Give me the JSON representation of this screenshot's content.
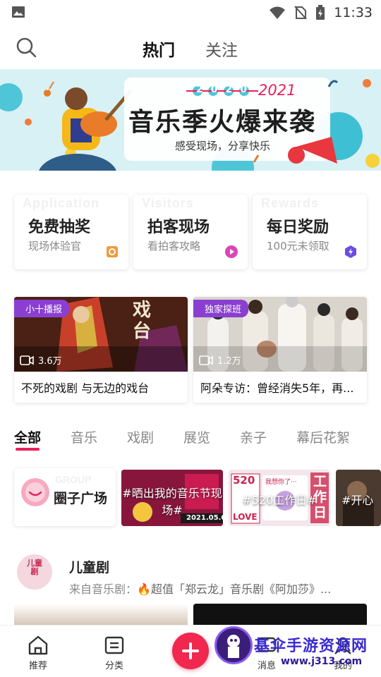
{
  "status_bar": {
    "time": "11:33"
  },
  "top_nav": {
    "tabs": [
      "热门",
      "关注"
    ]
  },
  "banner": {
    "headline": "音乐季火爆来袭",
    "year_old": "2020",
    "year_new": "2021",
    "subline": "感受现场，分享快乐"
  },
  "features": [
    {
      "title": "免费抽奖",
      "sub": "现场体验官",
      "bg_word": "Application",
      "icon": "gift-icon",
      "icon_color": "#f39a3a"
    },
    {
      "title": "拍客现场",
      "sub": "看拍客攻略",
      "bg_word": "Visitors",
      "icon": "play-icon",
      "icon_color": "#d946b8"
    },
    {
      "title": "每日奖励",
      "sub": "100元未领取",
      "bg_word": "Rewards",
      "icon": "reward-icon",
      "icon_color": "#6d4ce0"
    }
  ],
  "videos": [
    {
      "tag": "小十播报",
      "views": "3.6万",
      "title": "不死的戏剧 与无边的戏台",
      "overlay": "戏台"
    },
    {
      "tag": "独家探班",
      "views": "1.2万",
      "title": "阿朵专访：曾经消失5年，再..."
    }
  ],
  "category_tabs": [
    "全部",
    "音乐",
    "戏剧",
    "展览",
    "亲子",
    "幕后花絮"
  ],
  "topics": {
    "circle": {
      "label": "圈子广场",
      "ghost": "GROUP"
    },
    "items": [
      "#晒出我的音乐节现场#",
      "#520工作日#",
      "#开心"
    ],
    "topic1_date": "2021.05.0",
    "topic2_texts": [
      "520",
      "我想你了···",
      "LOVE",
      "工作日"
    ]
  },
  "section": {
    "name": "儿童剧",
    "avatar_text": "儿童剧",
    "source_prefix": "来自音乐剧：",
    "source_text": "超值「郑云龙」音乐剧《阿加莎》..."
  },
  "bottom_nav": {
    "items": [
      "推荐",
      "分类",
      "消息",
      "我的"
    ]
  },
  "watermark": {
    "line1": "基伞手游资源网",
    "line2": "www.j313.com"
  },
  "colors": {
    "accent": "#e8205b",
    "tag_purple": "#8a3fd1",
    "add_button": "#f0284f"
  }
}
